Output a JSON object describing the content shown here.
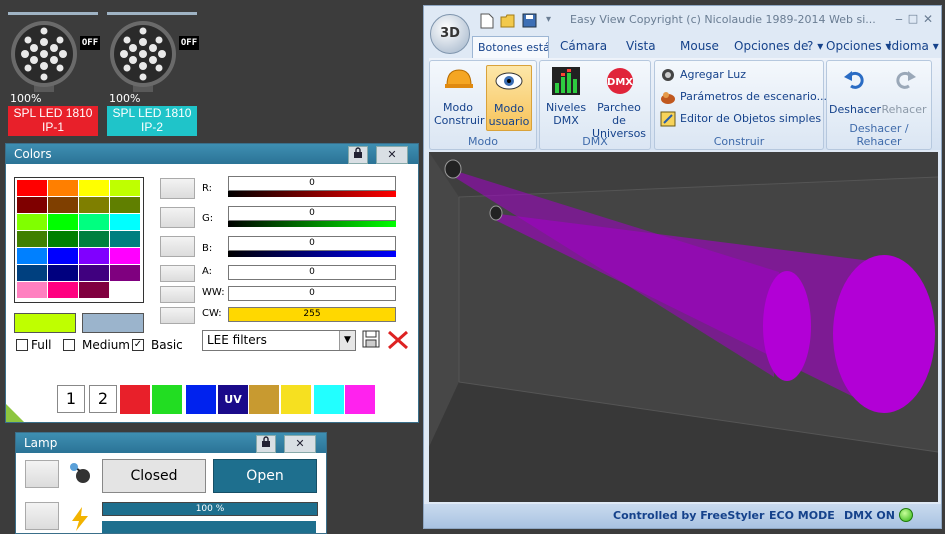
{
  "fixtures": [
    {
      "percent": "100%",
      "name_line1": "SPL LED 1810",
      "name_line2": "IP-1",
      "off_label": "OFF",
      "label_color": "#e8202a"
    },
    {
      "percent": "100%",
      "name_line1": "SPL LED 1810",
      "name_line2": "IP-2",
      "off_label": "OFF",
      "label_color": "#1fc4c9"
    }
  ],
  "colors_panel": {
    "title": "Colors",
    "lock_icon": "lock-icon",
    "close_label": "✕",
    "palette": [
      [
        "#ff0000",
        "#ff7f00",
        "#ffff00",
        "#bfff00"
      ],
      [
        "#7f0000",
        "#7f3f00",
        "#7f7f00",
        "#607f00"
      ],
      [
        "#80ff00",
        "#00ff00",
        "#00ff80",
        "#00ffff"
      ],
      [
        "#408000",
        "#008000",
        "#00803f",
        "#007f7f"
      ],
      [
        "#0080ff",
        "#0000ff",
        "#8000ff",
        "#ff00ff"
      ],
      [
        "#00407f",
        "#00007f",
        "#40007f",
        "#7f007f"
      ],
      [
        "#ff80c0",
        "#ff0080",
        "#800040",
        "#ffffff"
      ]
    ],
    "current_color": "#bfff00",
    "previous_color": "#9bb4cc",
    "channels": [
      {
        "label": "R:",
        "value": "0",
        "bar": "linear-gradient(to right,#000,#ff0000)"
      },
      {
        "label": "G:",
        "value": "0",
        "bar": "linear-gradient(to right,#000,#00ff00)"
      },
      {
        "label": "B:",
        "value": "0",
        "bar": "linear-gradient(to right,#000,#0000ff)"
      },
      {
        "label": "A:",
        "value": "0",
        "bar": ""
      },
      {
        "label": "WW:",
        "value": "0",
        "bar": ""
      },
      {
        "label": "CW:",
        "value": "255",
        "bar": ""
      }
    ],
    "mode_full": "Full",
    "mode_medium": "Medium",
    "mode_basic": "Basic",
    "basic_checked": "✓",
    "filter_select": "LEE filters",
    "preset_1": "1",
    "preset_2": "2",
    "uv_label": "UV",
    "quick_colors": [
      "#e8202a",
      "#22dd22",
      "#0022ee",
      "#1a0a8a",
      "#c89a30",
      "#f6e020",
      "#22ffff",
      "#ff22ee"
    ]
  },
  "lamp_panel": {
    "title": "Lamp",
    "closed_label": "Closed",
    "open_label": "Open",
    "dimmer": "100 %"
  },
  "window": {
    "logo": "3D",
    "title_text": "Easy View   Copyright (c) Nicolaudie 1989-2014   Web si...",
    "tabs": [
      "Botones está",
      "Cámara",
      "Vista",
      "Mouse",
      "Opciones de"
    ],
    "help": "?",
    "menu_options": "Opciones",
    "menu_language": "Idioma",
    "modo_construir": "Modo Construir",
    "modo_construir_1": "Modo",
    "modo_construir_2": "Construir",
    "modo_usuario_1": "Modo",
    "modo_usuario_2": "usuario",
    "group_modo": "Modo",
    "niveles_1": "Niveles",
    "niveles_2": "DMX",
    "parcheo_1": "Parcheo de",
    "parcheo_2": "Universos",
    "group_dmx": "DMX",
    "agregar_luz": "Agregar Luz",
    "parametros": "Parámetros de escenario...",
    "editor": "Editor de Objetos simples",
    "group_construir": "Construir",
    "deshacer": "Deshacer",
    "rehacer": "Rehacer",
    "group_undo": "Deshacer / Rehacer",
    "status_controlled": "Controlled by FreeStyler",
    "status_eco": "ECO MODE",
    "status_dmx": "DMX ON"
  }
}
